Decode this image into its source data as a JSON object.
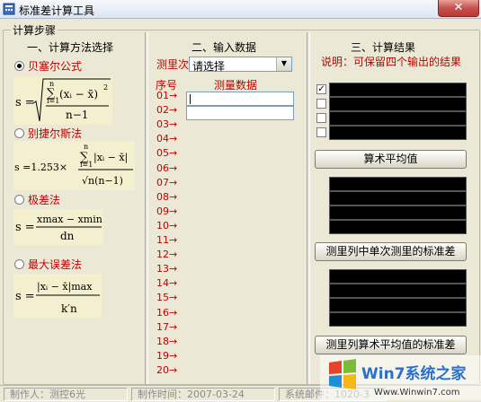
{
  "window": {
    "title": "标准差计算工具",
    "close_label": "✕"
  },
  "steps": {
    "group_label": "计算步骤"
  },
  "method_panel": {
    "heading": "一、计算方法选择",
    "methods": [
      {
        "label": "贝塞尔公式",
        "selected": true
      },
      {
        "label": "别捷尔斯法",
        "selected": false
      },
      {
        "label": "极差法",
        "selected": false
      },
      {
        "label": "最大误差法",
        "selected": false
      }
    ],
    "formulas": {
      "bessel": {
        "lhs": "s =",
        "top_n": "n",
        "sum_sym": "∑",
        "bottom_i": "i=1",
        "term": "(xᵢ − x̄)",
        "exp": "2",
        "denom": "n−1"
      },
      "peters": {
        "lhs": "s =1.253×",
        "top_n": "n",
        "sum_sym": "∑",
        "bottom_i": "i=1",
        "term": "|xᵢ − x̄|",
        "denom": "√n(n−1)"
      },
      "range": {
        "lhs": "s =",
        "num": "xmax − xmin",
        "denom": "dn"
      },
      "maxerr": {
        "lhs": "s =",
        "num": "|xᵢ − x̄|max",
        "denom": "k′n"
      }
    }
  },
  "input_panel": {
    "heading": "二、输入数据",
    "count_label": "测里次数n",
    "count_select": "请选择",
    "col_index": "序号",
    "col_data": "测量数据",
    "rows": [
      "01→",
      "02→",
      "03→",
      "04→",
      "05→",
      "06→",
      "07→",
      "08→",
      "09→",
      "10→",
      "11→",
      "12→",
      "13→",
      "14→",
      "15→",
      "16→",
      "17→",
      "18→",
      "19→",
      "20→"
    ]
  },
  "result_panel": {
    "heading": "三、计算结果",
    "note": "说明：可保留四个输出的结果",
    "checks": [
      true,
      false,
      false,
      false
    ],
    "btn_mean": "算术平均值",
    "btn_single": "测里列中单次测里的标准差",
    "btn_mean_std": "测里列算术平均值的标准差"
  },
  "status": {
    "author": "制作人：测控6光",
    "time": "制作时间：2007-03-24",
    "contact": "系统邮件：1020-3",
    "watermark_site": "Win7系统之家",
    "watermark_url": "Www.Winwin7.com"
  },
  "colors": {
    "accent_red": "#c00000",
    "formula_bg": "#f4efcf",
    "result_box": "#000000"
  }
}
